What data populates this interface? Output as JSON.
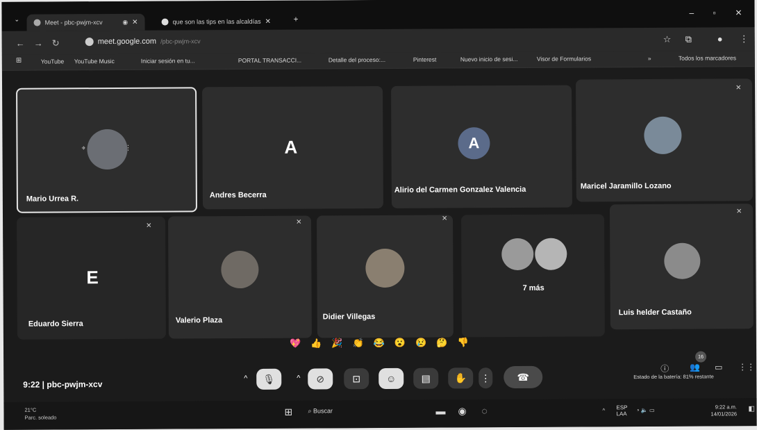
{
  "browser": {
    "tabs": [
      {
        "label": "Meet - pbc-pwjm-xcv"
      },
      {
        "label": "que son las tips en las alcaldías"
      }
    ],
    "address": {
      "url": "meet.google.com",
      "suffix": "/pbc-pwjm-xcv"
    },
    "bookmarks": [
      {
        "label": "YouTube"
      },
      {
        "label": "YouTube Music"
      },
      {
        "label": "Iniciar sesión en tu..."
      },
      {
        "label": "PORTAL TRANSACCI..."
      },
      {
        "label": "Detalle del proceso:..."
      },
      {
        "label": "Pinterest"
      },
      {
        "label": "Nuevo inicio de sesi..."
      },
      {
        "label": "Visor de Formularios"
      }
    ],
    "bookmarks_more": "»",
    "all_bookmarks": "Todos los marcadores"
  },
  "participants": [
    {
      "name": "Mario Urrea R.",
      "kind": "photo",
      "selected": true
    },
    {
      "name": "Andres Becerra",
      "kind": "letter",
      "letter": "A"
    },
    {
      "name": "Alirio del Carmen Gonzalez Valencia",
      "kind": "letter",
      "letter": "A"
    },
    {
      "name": "Maricel Jaramillo Lozano",
      "kind": "photo"
    },
    {
      "name": "Eduardo Sierra",
      "kind": "letter",
      "letter": "E"
    },
    {
      "name": "Valerio Plaza",
      "kind": "photo"
    },
    {
      "name": "Didier Villegas",
      "kind": "photo"
    },
    {
      "name": "7 más",
      "kind": "more"
    },
    {
      "name": "Luis helder Castaño",
      "kind": "photo"
    }
  ],
  "reactions": [
    "💖",
    "👍",
    "🎉",
    "👏",
    "😂",
    "😮",
    "😢",
    "🤔",
    "👎"
  ],
  "meeting": {
    "time": "9:22",
    "code": "pbc-pwjm-xcv"
  },
  "status": {
    "battery": "Estado de la batería: 81% restante",
    "participants_badge": "16"
  },
  "taskbar": {
    "weather_temp": "21°C",
    "weather_desc": "Parc. soleado",
    "search": "Buscar",
    "lang": "ESP",
    "lang2": "LAA",
    "clock_time": "9:22 a.m.",
    "clock_date": "14/01/2026"
  }
}
